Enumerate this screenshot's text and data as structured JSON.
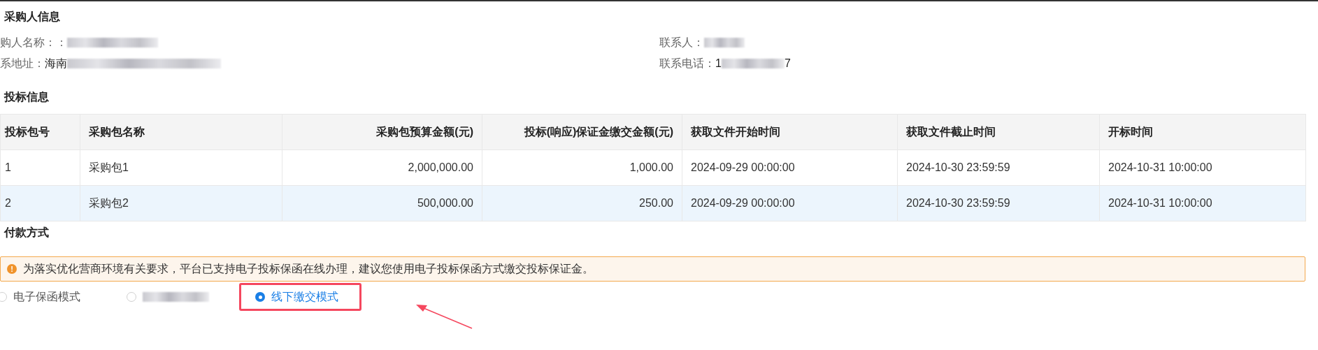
{
  "buyer": {
    "title": "采购人信息",
    "fields": [
      {
        "label": "购人名称：：",
        "redacted": true
      },
      {
        "label": "联系人：",
        "redacted": true
      },
      {
        "label": "系地址：",
        "value": "海南",
        "redacted": true
      },
      {
        "label": "联系电话：",
        "value": "1",
        "redacted": true,
        "value_end": "7"
      }
    ]
  },
  "bid": {
    "title": "投标信息",
    "table": {
      "columns": [
        "投标包号",
        "采购包名称",
        "采购包预算金额(元)",
        "投标(响应)保证金缴交金额(元)",
        "获取文件开始时间",
        "获取文件截止时间",
        "开标时间"
      ],
      "rows": [
        {
          "highlighted": false,
          "cells": [
            "1",
            "采购包1",
            "2,000,000.00",
            "1,000.00",
            "2024-09-29 00:00:00",
            "2024-10-30 23:59:59",
            "2024-10-31 10:00:00"
          ]
        },
        {
          "highlighted": true,
          "cells": [
            "2",
            "采购包2",
            "500,000.00",
            "250.00",
            "2024-09-29 00:00:00",
            "2024-10-30 23:59:59",
            "2024-10-31 10:00:00"
          ]
        }
      ]
    }
  },
  "payment": {
    "title": "付款方式",
    "notice": {
      "icon": "!",
      "text": "为落实优化营商环境有关要求，平台已支持电子投标保函在线办理，建议您使用电子投标保函方式缴交投标保证金。"
    },
    "options": [
      {
        "label": "电子保函模式",
        "redacted": false,
        "selected": false,
        "emphasized": false
      },
      {
        "redacted": true,
        "selected": false,
        "emphasized": false
      },
      {
        "label": "线下缴交模式",
        "redacted": false,
        "selected": true,
        "emphasized": true
      }
    ]
  }
}
